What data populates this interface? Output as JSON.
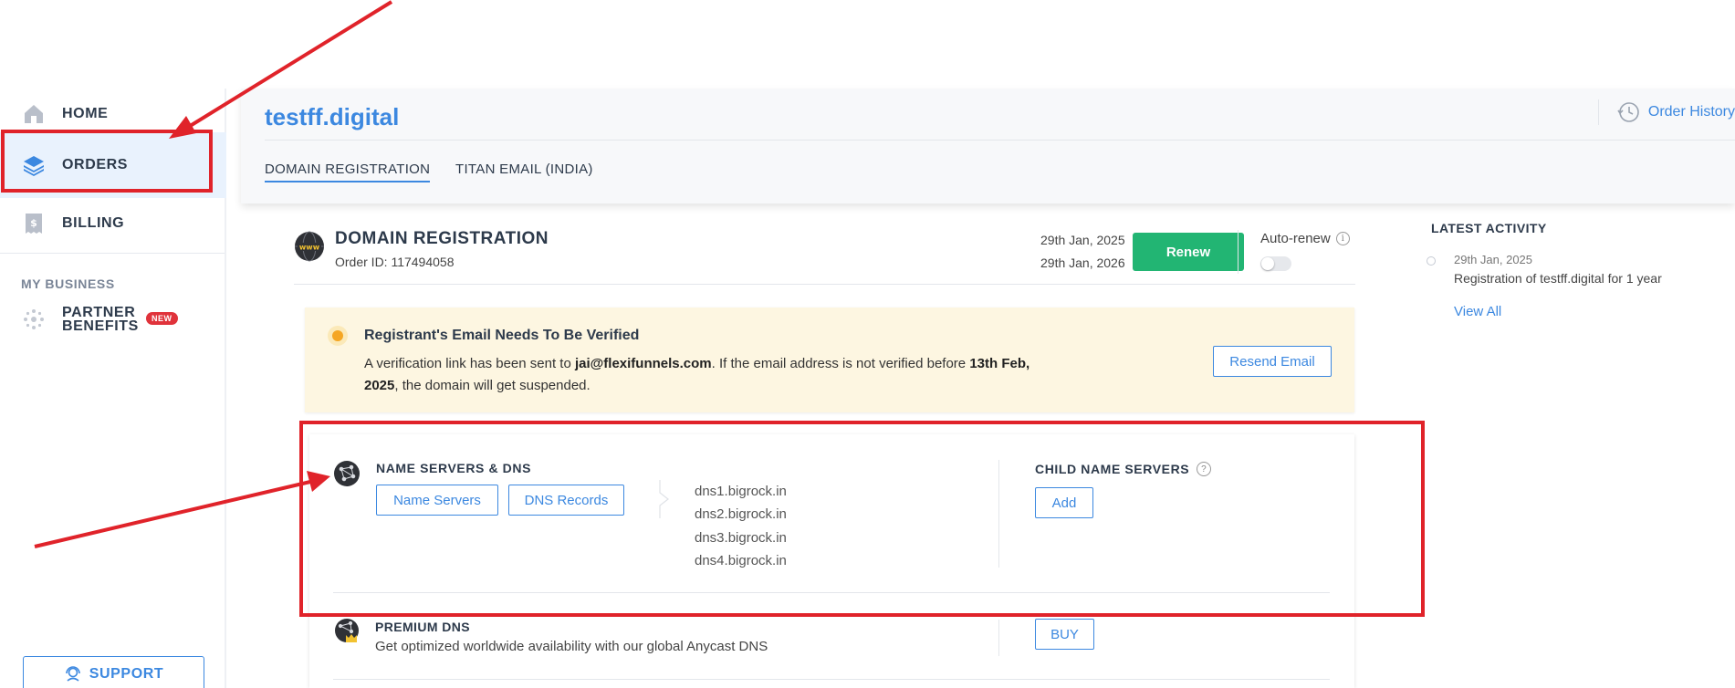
{
  "sidebar": {
    "items": [
      {
        "label": "HOME",
        "icon": "home-icon"
      },
      {
        "label": "ORDERS",
        "icon": "layers-icon"
      },
      {
        "label": "BILLING",
        "icon": "bill-icon"
      }
    ],
    "section_label": "MY BUSINESS",
    "partner": {
      "label": "PARTNER BENEFITS",
      "badge": "NEW",
      "icon": "partner-icon"
    },
    "support_label": "SUPPORT"
  },
  "header": {
    "domain": "testff.digital",
    "order_history": "Order History",
    "tabs": [
      {
        "label": "DOMAIN REGISTRATION",
        "active": true
      },
      {
        "label": "TITAN EMAIL (INDIA)",
        "active": false
      }
    ]
  },
  "order": {
    "title": "DOMAIN REGISTRATION",
    "order_id": "Order ID: 117494058",
    "start_date": "29th Jan, 2025",
    "end_date": "29th Jan, 2026",
    "renew_label": "Renew",
    "autorenew_label": "Auto-renew",
    "autorenew_on": false
  },
  "alert": {
    "title": "Registrant's Email Needs To Be Verified",
    "msg_pre": "A verification link has been sent to ",
    "email": "jai@flexifunnels.com",
    "msg_mid": ". If the email address is not verified before ",
    "deadline": "13th Feb, 2025",
    "msg_post": ", the domain will get suspended.",
    "button": "Resend Email"
  },
  "dns": {
    "title": "NAME SERVERS & DNS",
    "btn_nameservers": "Name Servers",
    "btn_records": "DNS Records",
    "nameservers": [
      "dns1.bigrock.in",
      "dns2.bigrock.in",
      "dns3.bigrock.in",
      "dns4.bigrock.in"
    ],
    "child_title": "CHILD NAME SERVERS",
    "child_add": "Add"
  },
  "premium_dns": {
    "title": "PREMIUM DNS",
    "desc": "Get optimized worldwide availability with our global Anycast DNS",
    "button": "BUY"
  },
  "activity": {
    "title": "LATEST ACTIVITY",
    "items": [
      {
        "date": "29th Jan, 2025",
        "text": "Registration of testff.digital for 1 year"
      }
    ],
    "view_all": "View All"
  },
  "colors": {
    "accent": "#3c88e0",
    "renew": "#22b573",
    "alert_bg": "#fdf6e1",
    "annotation": "#e0232a"
  }
}
